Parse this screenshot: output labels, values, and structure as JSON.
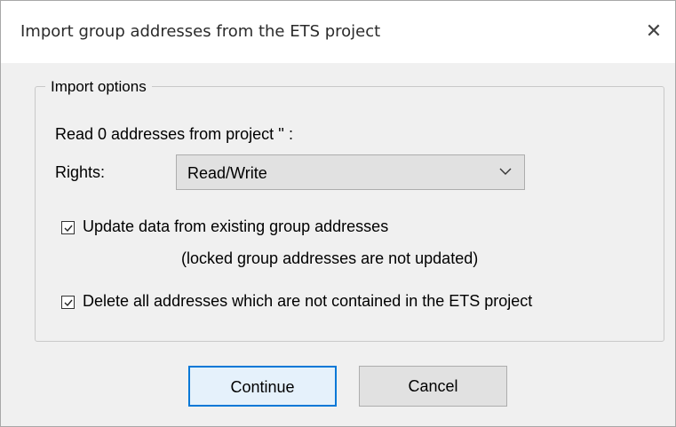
{
  "window": {
    "title": "Import group addresses from the ETS project",
    "close_glyph": "✕"
  },
  "options": {
    "group_label": "Import options",
    "read_info": "Read 0 addresses from project '' :",
    "rights_label": "Rights:",
    "rights_value": "Read/Write",
    "update_label": "Update data from existing group addresses",
    "update_note": "(locked group addresses are not updated)",
    "update_checked": true,
    "delete_label": "Delete all addresses which are not contained in the ETS project",
    "delete_checked": true
  },
  "buttons": {
    "continue_label": "Continue",
    "cancel_label": "Cancel"
  },
  "colors": {
    "accent": "#0078d7",
    "dialog_bg": "#f0f0f0",
    "titlebar_bg": "#ffffff"
  },
  "icons": [
    "close-icon",
    "chevron-down-icon",
    "checkmark-icon"
  ]
}
